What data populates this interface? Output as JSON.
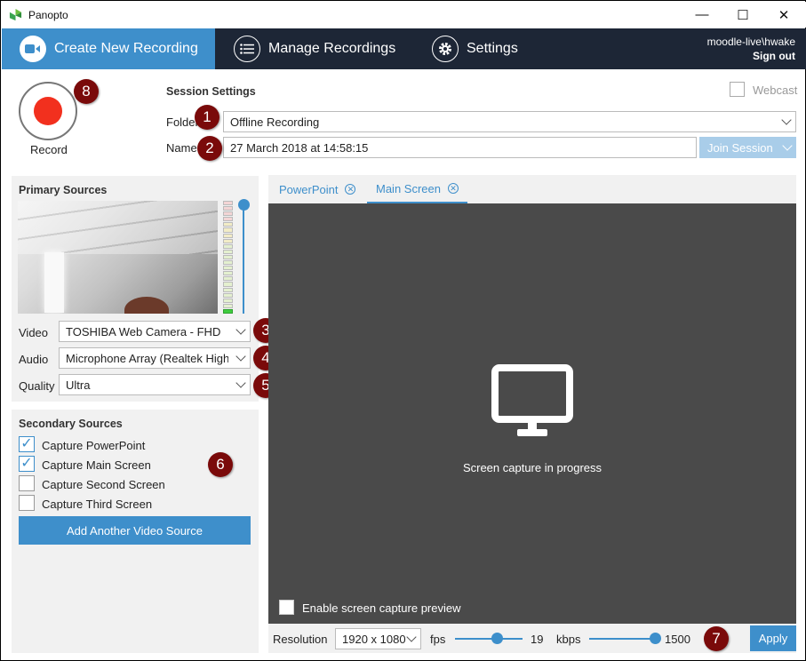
{
  "window": {
    "title": "Panopto",
    "minimize": "—",
    "maximize": "☐",
    "close": "✕"
  },
  "nav": {
    "tabs": [
      {
        "label": "Create New Recording"
      },
      {
        "label": "Manage Recordings"
      },
      {
        "label": "Settings"
      }
    ],
    "user": "moodle-live\\hwake",
    "sign_out": "Sign out"
  },
  "record": {
    "label": "Record"
  },
  "session": {
    "heading": "Session Settings",
    "folder_label": "Folder",
    "folder_value": "Offline Recording",
    "name_label": "Name",
    "name_value": "27 March 2018 at 14:58:15",
    "webcast_label": "Webcast",
    "webcast_checked": false,
    "join_session": "Join Session"
  },
  "primary": {
    "heading": "Primary Sources",
    "video_label": "Video",
    "video_value": "TOSHIBA Web Camera - FHD",
    "audio_label": "Audio",
    "audio_value": "Microphone Array (Realtek High Definition Audio)",
    "quality_label": "Quality",
    "quality_value": "Ultra"
  },
  "secondary": {
    "heading": "Secondary Sources",
    "items": [
      {
        "label": "Capture PowerPoint",
        "checked": true
      },
      {
        "label": "Capture Main Screen",
        "checked": true
      },
      {
        "label": "Capture Second Screen",
        "checked": false
      },
      {
        "label": "Capture Third Screen",
        "checked": false
      }
    ],
    "add_button": "Add Another Video Source"
  },
  "preview": {
    "tabs": [
      {
        "label": "PowerPoint"
      },
      {
        "label": "Main Screen"
      }
    ],
    "message": "Screen capture in progress",
    "enable_preview_label": "Enable screen capture preview"
  },
  "capture": {
    "resolution_label": "Resolution",
    "resolution_value": "1920 x 1080",
    "fps_label": "fps",
    "fps_value": "19",
    "kbps_label": "kbps",
    "kbps_value": "1500",
    "apply": "Apply"
  },
  "badges": [
    "1",
    "2",
    "3",
    "4",
    "5",
    "6",
    "7",
    "8"
  ],
  "colors": {
    "accent": "#3e8fcb",
    "nav": "#1d2636",
    "record": "#f2301e",
    "badge": "#7a0a0a"
  }
}
